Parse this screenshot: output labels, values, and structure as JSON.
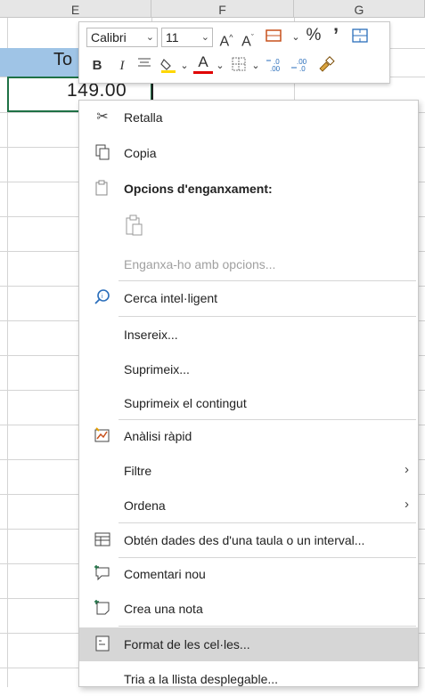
{
  "columns": [
    {
      "letter": "E"
    },
    {
      "letter": "F"
    },
    {
      "letter": "G"
    }
  ],
  "sheet": {
    "header_text": "To",
    "cell_value": "149.00"
  },
  "toolbar": {
    "font_name": "Calibri",
    "font_size": "11",
    "bold": "B",
    "italic": "I",
    "percent": "%",
    "comma": "’"
  },
  "menu": {
    "items": [
      {
        "label": "Retalla",
        "icon": "scissors-icon"
      },
      {
        "label": "Copia",
        "icon": "copy-icon"
      },
      {
        "label": "Opcions d'enganxament:",
        "icon": "paste-icon"
      },
      {
        "label": "Enganxa-ho amb opcions...",
        "icon": ""
      },
      {
        "label": "Cerca intel·ligent",
        "icon": "smart-search-icon"
      },
      {
        "label": "Insereix...",
        "icon": ""
      },
      {
        "label": "Suprimeix...",
        "icon": ""
      },
      {
        "label": "Suprimeix el contingut",
        "icon": ""
      },
      {
        "label": "Anàlisi ràpid",
        "icon": "quick-analysis-icon"
      },
      {
        "label": "Filtre",
        "icon": ""
      },
      {
        "label": "Ordena",
        "icon": ""
      },
      {
        "label": "Obtén dades des d'una taula o un interval...",
        "icon": "table-icon"
      },
      {
        "label": "Comentari nou",
        "icon": "new-comment-icon"
      },
      {
        "label": "Crea una nota",
        "icon": "new-note-icon"
      },
      {
        "label": "Format de les cel·les...",
        "icon": "format-cells-icon"
      },
      {
        "label": "Tria a la llista desplegable...",
        "icon": ""
      }
    ]
  }
}
